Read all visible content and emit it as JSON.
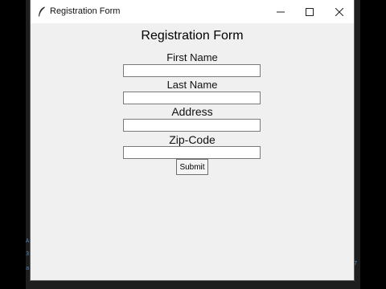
{
  "window": {
    "title": "Registration Form",
    "app_icon": "feather-icon",
    "controls": [
      "minimize-icon",
      "maximize-icon",
      "close-icon"
    ]
  },
  "form": {
    "heading": "Registration Form",
    "fields": [
      {
        "label": "First Name",
        "value": ""
      },
      {
        "label": "Last Name",
        "value": ""
      },
      {
        "label": "Address",
        "value": ""
      },
      {
        "label": "Zip-Code",
        "value": ""
      }
    ],
    "submit_label": "Submit"
  },
  "colors": {
    "window_bg": "#f0f0f0",
    "titlebar_bg": "#ffffff",
    "entry_bg": "#ffffff",
    "entry_border": "#7a7a7a",
    "desktop_bg": "#000000"
  }
}
